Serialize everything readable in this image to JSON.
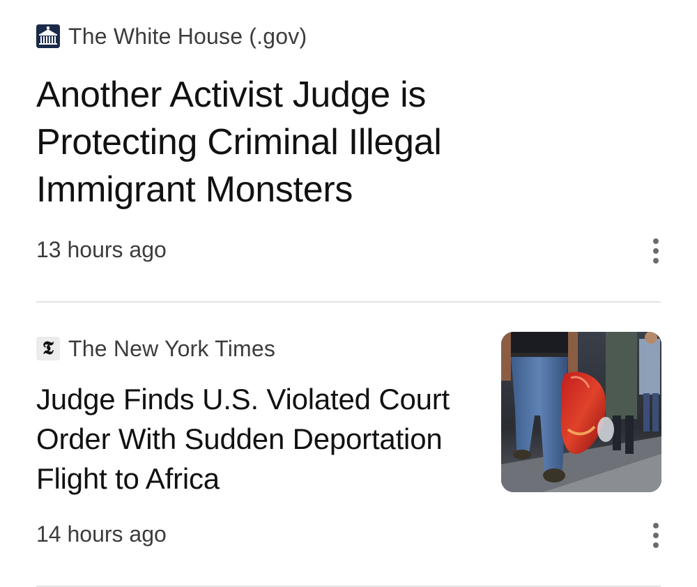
{
  "feed": {
    "articles": [
      {
        "source": "The White House (.gov)",
        "favicon": "white-house-icon",
        "headline": "Another Activist Judge is Protecting Criminal Illegal Immigrant Monsters",
        "timestamp": "13 hours ago",
        "has_thumbnail": false
      },
      {
        "source": "The New York Times",
        "favicon": "nyt-icon",
        "favicon_glyph": "𝕿",
        "headline": "Judge Finds U.S. Violated Court Order With Sudden Deportation Flight to Africa",
        "timestamp": "14 hours ago",
        "has_thumbnail": true
      }
    ]
  },
  "colors": {
    "headline": "#111111",
    "meta_text": "#3c3c3c",
    "divider": "#e3e3e3",
    "menu_dots": "#6b6b6b",
    "wh_favicon_bg": "#1b2a4a"
  }
}
